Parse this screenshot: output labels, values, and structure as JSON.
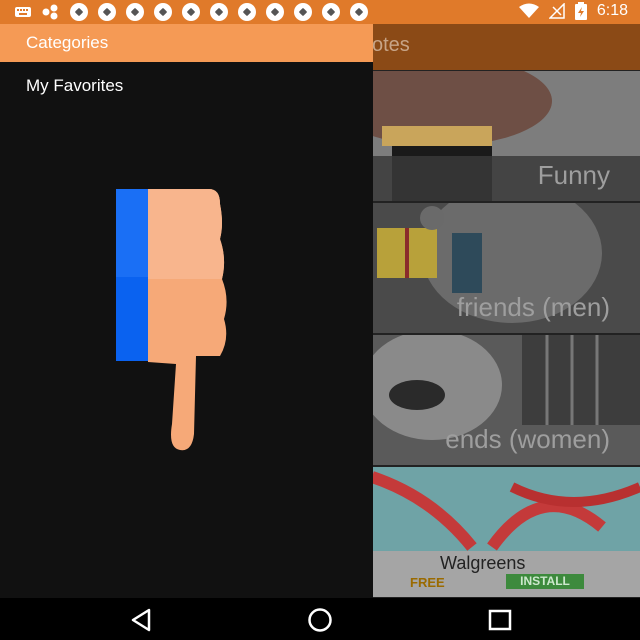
{
  "status_bar": {
    "time": "6:18",
    "background_color": "#e07a2a",
    "icons": [
      "keyboard-icon",
      "share-icon",
      "soccer-ball-icon",
      "wifi-icon",
      "signal-icon",
      "battery-icon"
    ]
  },
  "app": {
    "title": "otes",
    "categories": [
      {
        "label": "Funny"
      },
      {
        "label": "friends (men)"
      },
      {
        "label": "ends (women)"
      }
    ],
    "ad": {
      "title": "Walgreens",
      "free": "FREE",
      "install": "INSTALL"
    }
  },
  "drawer": {
    "header": "Categories",
    "header_color": "#f59a55",
    "items": [
      {
        "label": "My Favorites"
      }
    ],
    "illustration": "thumbs-down-icon"
  },
  "nav_bar": {
    "buttons": [
      "back-icon",
      "home-icon",
      "recents-icon"
    ]
  }
}
